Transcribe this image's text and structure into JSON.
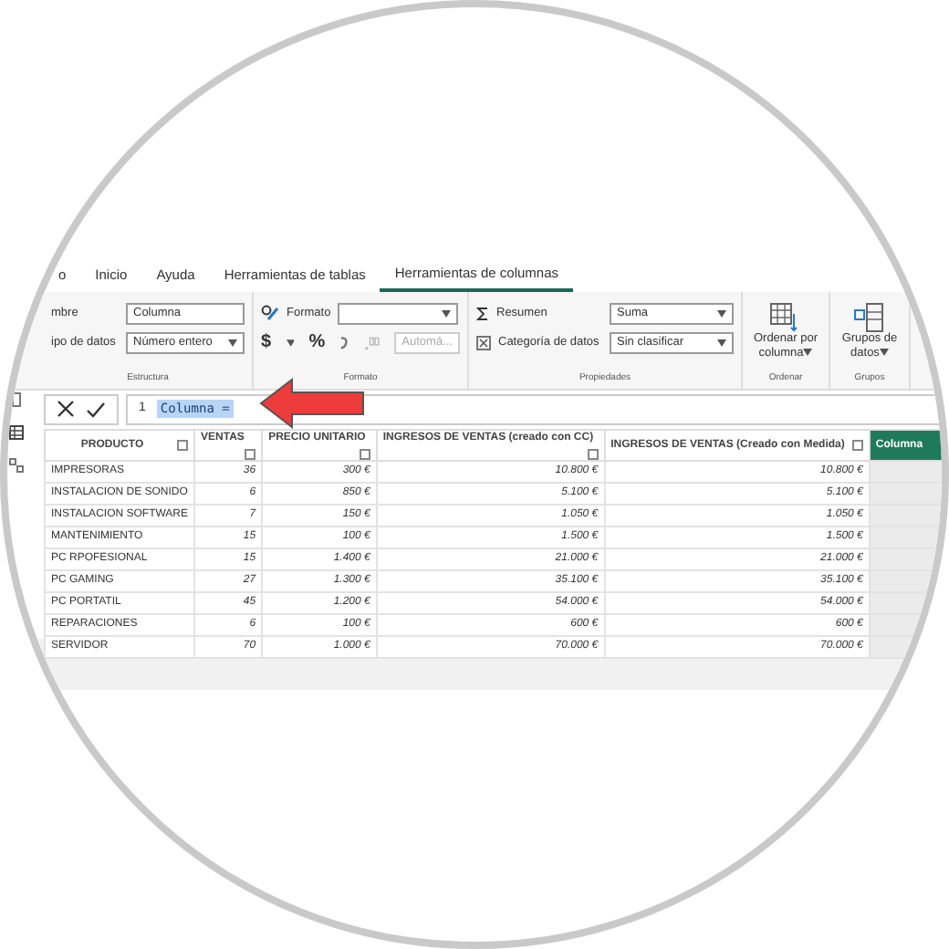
{
  "ribbon_tabs": [
    {
      "label": "o",
      "selected": false
    },
    {
      "label": "Inicio",
      "selected": false
    },
    {
      "label": "Ayuda",
      "selected": false
    },
    {
      "label": "Herramientas de tablas",
      "selected": false
    },
    {
      "label": "Herramientas de columnas",
      "selected": true
    }
  ],
  "estructura": {
    "title": "Estructura",
    "name_label": "mbre",
    "name_value": "Columna",
    "type_label": "ipo de datos",
    "type_value": "Número entero"
  },
  "formato": {
    "title": "Formato",
    "format_label": "Formato",
    "currency": "$",
    "percent": "%",
    "decimals_placeholder": "Automá..."
  },
  "propiedades": {
    "title": "Propiedades",
    "summary_label": "Resumen",
    "summary_value": "Suma",
    "category_label": "Categoría de datos",
    "category_value": "Sin clasificar"
  },
  "ordenar": {
    "title": "Ordenar",
    "button_lines": [
      "Ordenar por",
      "columna"
    ]
  },
  "grupos": {
    "title": "Grupos",
    "button_lines": [
      "Grupos de",
      "datos"
    ]
  },
  "formula_bar": {
    "line_number": "1",
    "value": "Columna = "
  },
  "table": {
    "columns": [
      {
        "label": "PRODUCTO",
        "selected": false
      },
      {
        "label": "VENTAS",
        "selected": false
      },
      {
        "label": "PRECIO UNITARIO",
        "selected": false
      },
      {
        "label": "INGRESOS DE VENTAS (creado con CC)",
        "selected": false
      },
      {
        "label": "INGRESOS DE VENTAS (Creado con Medida)",
        "selected": false
      },
      {
        "label": "Columna",
        "selected": true
      }
    ],
    "rows": [
      [
        "IMPRESORAS",
        "36",
        "300 €",
        "10.800 €",
        "10.800 €"
      ],
      [
        "INSTALACION DE SONIDO",
        "6",
        "850 €",
        "5.100 €",
        "5.100 €"
      ],
      [
        "INSTALACION SOFTWARE",
        "7",
        "150 €",
        "1.050 €",
        "1.050 €"
      ],
      [
        "MANTENIMIENTO",
        "15",
        "100 €",
        "1.500 €",
        "1.500 €"
      ],
      [
        "PC RPOFESIONAL",
        "15",
        "1.400 €",
        "21.000 €",
        "21.000 €"
      ],
      [
        "PC GAMING",
        "27",
        "1.300 €",
        "35.100 €",
        "35.100 €"
      ],
      [
        "PC PORTATIL",
        "45",
        "1.200 €",
        "54.000 €",
        "54.000 €"
      ],
      [
        "REPARACIONES",
        "6",
        "100 €",
        "600 €",
        "600 €"
      ],
      [
        "SERVIDOR",
        "70",
        "1.000 €",
        "70.000 €",
        "70.000 €"
      ]
    ]
  }
}
